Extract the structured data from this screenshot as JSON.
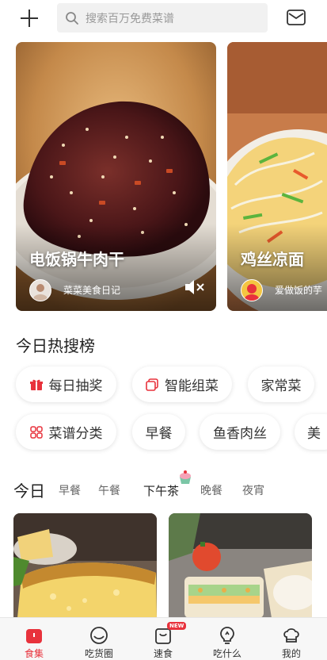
{
  "search": {
    "placeholder": "搜索百万免费菜谱"
  },
  "featured_cards": [
    {
      "title": "电饭锅牛肉干",
      "author": "菜菜美食日记"
    },
    {
      "title": "鸡丝凉面",
      "author": "爱做饭的芋"
    }
  ],
  "hot_search": {
    "title": "今日热搜榜",
    "row1": [
      "每日抽奖",
      "智能组菜",
      "家常菜"
    ],
    "row2": [
      "菜谱分类",
      "早餐",
      "鱼香肉丝",
      "美"
    ]
  },
  "meal_tabs": {
    "active": "今日",
    "items": [
      "早餐",
      "午餐",
      "下午茶",
      "晚餐",
      "夜宵"
    ]
  },
  "bottom_nav": {
    "items": [
      "食集",
      "吃货圈",
      "速食",
      "吃什么",
      "我的"
    ],
    "new_badge": "NEW"
  },
  "colors": {
    "accent": "#e8323c"
  }
}
